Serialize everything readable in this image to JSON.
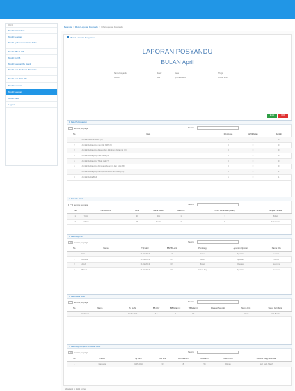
{
  "sidebar": {
    "header": "MENU",
    "items": [
      {
        "label": "Modul LCD Admin",
        "active": false
      },
      {
        "label": "Modul Lengkap",
        "active": false
      },
      {
        "label": "Modul Aplikasi pendataan balita",
        "active": false,
        "double": true
      },
      {
        "label": "Modul TBC & IPA",
        "active": false
      },
      {
        "label": "Modul Ibu KB",
        "active": false
      },
      {
        "label": "Modul Laporan Ibu Hamil",
        "active": false
      },
      {
        "label": "Modul data Ibu hamil & bersalin",
        "active": false,
        "double": true
      },
      {
        "label": "Modul data PUS WB",
        "active": false
      },
      {
        "label": "Modul Laporan",
        "active": false
      },
      {
        "label": "Modul Laporan",
        "active": true
      },
      {
        "label": "Modul Data",
        "active": false
      },
      {
        "label": "Logout",
        "active": false
      }
    ]
  },
  "breadcrumb": [
    "Beranda",
    "Modul Laporan Posyandu",
    "Lihat Laporan Posyandu"
  ],
  "panel_title": "Modul Laporan Posyandu",
  "report": {
    "title": "LAPORAN POSYANDU",
    "subtitle": "BULAN April",
    "meta": {
      "l1": "Nama Posyandu",
      "v1": "Mawar",
      "l2": "Desa",
      "v2": "Tlogo",
      "l3": "Kecam",
      "v3": "Jetis",
      "l4": "Lp. Kabupaten",
      "v4": "01 Juli 2013"
    }
  },
  "buttons": {
    "excel": "Excel",
    "pdf": "PDF"
  },
  "controls": {
    "per_page": "records per page",
    "select": "10",
    "search": "Search:"
  },
  "sections": [
    {
      "title": "1. Data Pertimbangan",
      "cols": [
        "No",
        "Data",
        "0-11 bulan",
        "12-59 bulan",
        "Jumlah"
      ],
      "widths": [
        6,
        60,
        11,
        11,
        12
      ],
      "align": [
        "c",
        "l",
        "c",
        "c",
        "c"
      ],
      "rows": [
        [
          "1",
          "Jumlah Seluruh balita (S)",
          "0",
          "0",
          "0"
        ],
        [
          "2",
          "Jumlah balita yang memiliki KMS (K)",
          "0",
          "0",
          "0"
        ],
        [
          "3",
          "Jumlah balita yang datang dan ditimbang bulan ini (D)",
          "0",
          "0",
          "0"
        ],
        [
          "4",
          "Jumlah balita yang naik berat (N)",
          "0",
          "0",
          "0"
        ],
        [
          "5",
          "Jumlah balita yang Tidak naik (T)",
          "0",
          "0",
          "0"
        ],
        [
          "6",
          "Jumlah balita yang ditimbang bulan ini dan tidak (B)",
          "0",
          "0",
          "0"
        ],
        [
          "7",
          "Jumlah balita yang baru pertama kali ditimbang (O)",
          "0",
          "0",
          "1"
        ],
        [
          "8",
          "Jumlah balita BGM",
          "1",
          "0",
          "1"
        ]
      ]
    },
    {
      "title": "2. Data Ibu Hamil",
      "cols": [
        "No",
        "Nama Bumil",
        "Umur",
        "Nama Suami",
        "Hamil Ke",
        "Umur Kehamilan (bulan)",
        "Tempat Periksa"
      ],
      "widths": [
        7,
        20,
        8,
        11,
        9,
        30,
        15
      ],
      "align": [
        "c",
        "l",
        "c",
        "c",
        "c",
        "c",
        "c"
      ],
      "rows": [
        [
          "1",
          "Yanti",
          "30",
          "Slet",
          "1",
          "7",
          "Bidan"
        ],
        [
          "2",
          "Murni",
          "25",
          "Sumiri",
          "2",
          "5",
          "Puskesmas"
        ]
      ]
    },
    {
      "title": "3. Data Bayi Lahir",
      "cols": [
        "No",
        "Nama",
        "Tgl Lahir",
        "BB/PB Lahir",
        "Penolong",
        "Apuntan Operasi",
        "Nama Ortu"
      ],
      "widths": [
        6,
        22,
        13,
        11,
        16,
        18,
        14
      ],
      "align": [
        "c",
        "l",
        "c",
        "c",
        "c",
        "c",
        "c"
      ],
      "rows": [
        [
          "1",
          "Fitri",
          "01.02.2013",
          "3",
          "Dukun",
          "Apuntan",
          "Lando"
        ],
        [
          "2",
          "Rizalda",
          "01.02.2013",
          "3.5",
          "Dukun",
          "Apuntan",
          "Lando"
        ],
        [
          "3",
          "Ayub",
          "01.02.2013",
          "3.5",
          "Bidan",
          "Operasi",
          "Hermina"
        ],
        [
          "4",
          "Batura",
          "01.02.2013",
          "3.5",
          "Dukun bay",
          "Apuntan",
          "Hermina"
        ]
      ]
    },
    {
      "title": "4. Data Balita BGM",
      "cols": [
        "No",
        "Nama",
        "Tgl Lahir",
        "BB lahir",
        "BB bulan ini",
        "TB bulan ini",
        "Riwayat Penyakit",
        "Nama Ortu",
        "Status Gizi Balita"
      ],
      "widths": [
        6,
        17,
        12,
        9,
        8,
        8,
        14,
        11,
        15
      ],
      "align": [
        "c",
        "l",
        "c",
        "c",
        "c",
        "c",
        "c",
        "c",
        "c"
      ],
      "rows": [
        [
          "1",
          "Nadianta",
          "01.05.2014",
          "3.5",
          "8",
          "54",
          "",
          "Dimas",
          "Gizi Buruk"
        ]
      ]
    },
    {
      "title": "5. Data Bayi dengan Pemberian ASI 1",
      "cols": [
        "No",
        "Nama",
        "Tgl Lahir",
        "BB lahir",
        "BB bulan ini",
        "TB bulan ini",
        "Nama Ortu",
        "ASI Kali yang Diberikan"
      ],
      "widths": [
        6,
        19,
        13,
        9,
        9,
        10,
        11,
        23
      ],
      "align": [
        "c",
        "c",
        "c",
        "c",
        "c",
        "c",
        "c",
        "c"
      ],
      "rows": [
        [
          "1",
          "Nadianta",
          "01.05.2014",
          "3.5",
          "8",
          "54",
          "Dimas",
          "Hari Ke-1 Masih"
        ]
      ]
    }
  ],
  "footer_note": "Showing 1 to 1 of 1 entries"
}
